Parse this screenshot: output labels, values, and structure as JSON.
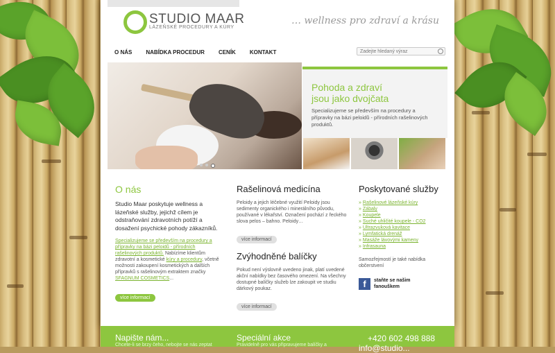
{
  "brand": {
    "name": "STUDIO MAAR",
    "subtitle": "LÁZEŇSKÉ PROCEDURY A KÚRY",
    "tagline": "… wellness pro zdraví a krásu",
    "accent": "#8dc63f"
  },
  "nav": [
    {
      "label": "O NÁS"
    },
    {
      "label": "NABÍDKA PROCEDUR"
    },
    {
      "label": "CENÍK"
    },
    {
      "label": "KONTAKT"
    }
  ],
  "search": {
    "placeholder": "Zadejte hledaný výraz",
    "icon": "search-icon"
  },
  "promo": {
    "title_line1": "Pohoda a zdraví",
    "title_line2": "jsou jako dvojčata",
    "text": "Specializujeme se především na procedury a přípravky na bázi peloidů - přírodních rašelinových produktů."
  },
  "about": {
    "title": "O nás",
    "intro": "Studio Maar poskytuje wellness a lázeňské služby, jejichž cílem je odstraňování zdravotních potíží a dosažení psychické pohody zákazníků.",
    "link1": "Specializujeme se především na procedury a přípravky na bázi peloidů - přírodních rašelinových produktů.",
    "text2": " Nabízíme klientům zdravotní a kosmetické ",
    "link2": "kúry a procedury",
    "text3": ", včetně možnosti zakoupení kosmetických a dalších přípravků s rašelinovým extraktem značky ",
    "link3": "SFAGNUM COSMETICS",
    "text4": "...",
    "button": "více informací"
  },
  "peat": {
    "title": "Rašelinová medicína",
    "text": "Peloidy a jejich léčebné využití Peloidy jsou sedimenty organického i minerálního původu, používané v lékařství. Označení pochází z řeckého slova pelos – bahno. Peloidy…",
    "button": "více informací"
  },
  "packages": {
    "title": "Zvýhodněné balíčky",
    "text": "Pokud není výslovně uvedeno jinak, platí uvedené akční nabídky bez časového omezení. Na všechny dostupné balíčky služeb lze zakoupit ve studiu dárkový poukaz.",
    "button": "více informací"
  },
  "services": {
    "title": "Poskytované služby",
    "items": [
      "Rašelinové lázeňské kúry",
      "Zábaly",
      "Koupele",
      "Suché uhličité koupele - CO2",
      "Ultrazvuková kavitace",
      "Lymfatická drenáž",
      "Masáže lávovými kameny",
      "Infrasauna"
    ],
    "note": "Samozřejmostí je také nabídka občerstvení",
    "fb_text": "staňte se našim fanouškem",
    "fb_icon": "facebook-icon"
  },
  "footer": {
    "col1_title": "Napište nám...",
    "col1_text": "Chcete-li se brzy čeho, nebojte se nás zeptat",
    "col2_title": "Speciální akce",
    "col2_text": "Pravidelně pro vás připravujeme balíčky a",
    "phone": "+420 602 498 888",
    "email": "info@studio..."
  }
}
